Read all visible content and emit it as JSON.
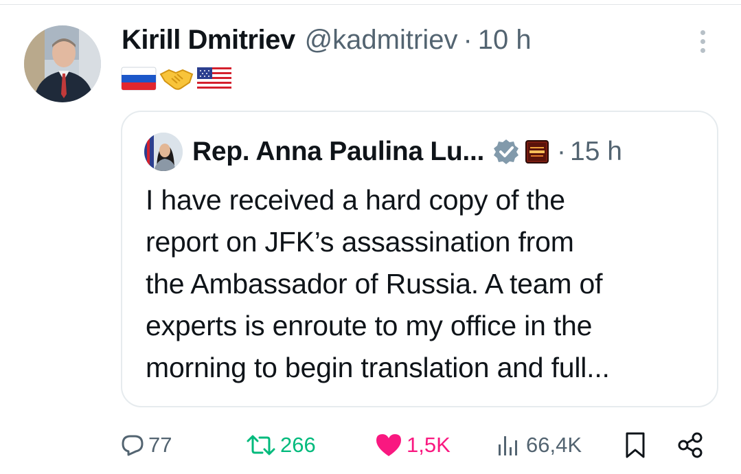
{
  "tweet": {
    "author_name": "Kirill Dmitriev",
    "author_handle": "@kadmitriev",
    "separator": "·",
    "time": "10 h",
    "emojis": [
      "russia-flag",
      "handshake",
      "usa-flag"
    ]
  },
  "quote": {
    "author_name": "Rep. Anna Paulina Lu...",
    "separator": "·",
    "time": "15 h",
    "text": "I have received a hard copy of the\nreport on JFK’s assassination from\nthe Ambassador of Russia. A team of\nexperts is enroute to my office in the\nmorning to begin translation and full...",
    "badges": [
      "verified-badge",
      "affiliate-badge"
    ]
  },
  "actions": {
    "replies": "77",
    "reposts": "266",
    "likes": "1,5K",
    "views": "66,4K"
  },
  "colors": {
    "text_primary": "#0f1419",
    "text_secondary": "#536471",
    "repost_green": "#00ba7c",
    "like_pink": "#f91880",
    "verified_gray": "#829aab"
  }
}
